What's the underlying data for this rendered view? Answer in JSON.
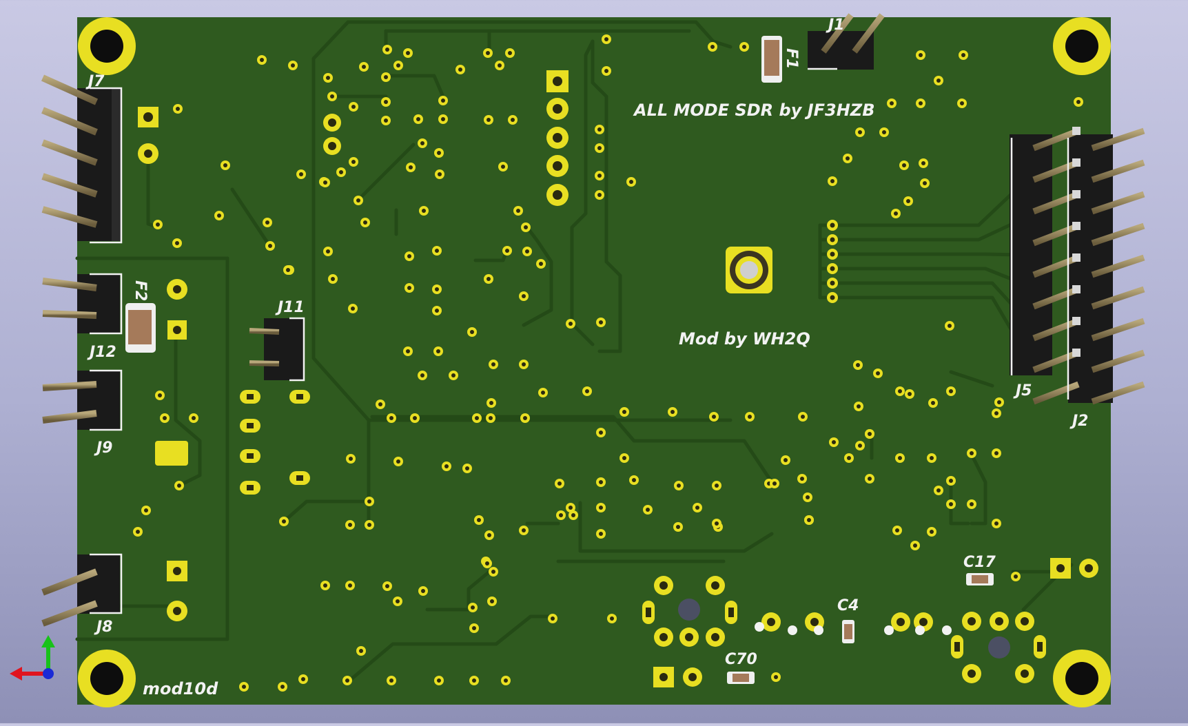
{
  "board": {
    "silkscreen": {
      "title": "ALL MODE SDR by JF3HZB",
      "subtitle": "Mod by WH2Q",
      "revision": "mod10d"
    },
    "references": {
      "j1": "J1",
      "j2": "J2",
      "j5": "J5",
      "j7": "J7",
      "j8": "J8",
      "j9": "J9",
      "j11": "J11",
      "j12": "J12",
      "f1": "F1",
      "f2": "F2",
      "c4": "C4",
      "c17": "C17",
      "c70": "C70"
    }
  },
  "colors": {
    "solder_mask": "#2f5a1f",
    "trace": "#234917",
    "copper_pad": "#e8df22",
    "silkscreen": "#f2f2f2",
    "header_body": "#1a1a1a",
    "pin_metal": "#8a7a55",
    "background_top": "#c9c9e4",
    "background_bottom": "#8e90b6"
  },
  "axes_gizmo": {
    "x_color": "#e0141e",
    "y_color": "#18c21a",
    "z_color": "#1a2ad6"
  }
}
